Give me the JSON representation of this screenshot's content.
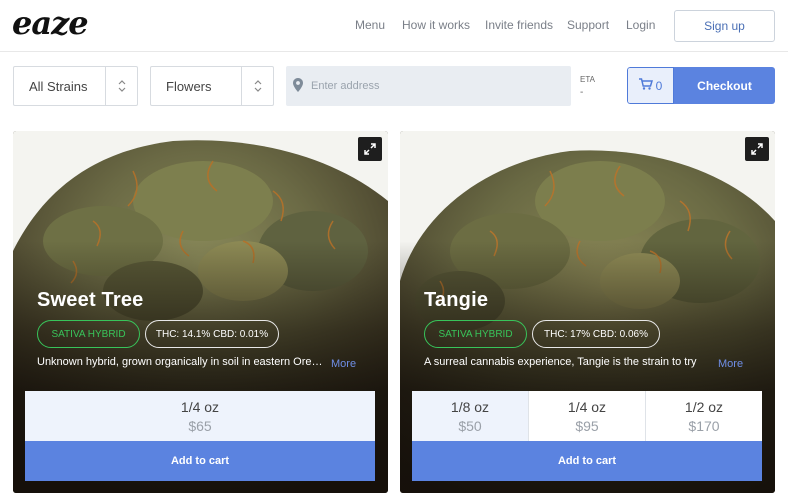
{
  "header": {
    "logo": "eaze",
    "nav": [
      "Menu",
      "How it works",
      "Invite friends",
      "Support",
      "Login"
    ],
    "signup_label": "Sign up"
  },
  "filters": {
    "strain": "All Strains",
    "category": "Flowers",
    "address_placeholder": "Enter address",
    "eta_label": "ETA",
    "eta_value": "-",
    "cart_count": "0",
    "checkout_label": "Checkout"
  },
  "products": [
    {
      "name": "Sweet Tree",
      "type": "SATIVA HYBRID",
      "potency": "THC: 14.1% CBD: 0.01%",
      "description": "Unknown hybrid, grown organically in soil in eastern Oregon",
      "more_label": "More",
      "options": [
        {
          "size": "1/4 oz",
          "price": "$65"
        }
      ],
      "add_label": "Add to cart"
    },
    {
      "name": "Tangie",
      "type": "SATIVA HYBRID",
      "potency": "THC: 17% CBD: 0.06%",
      "description": "A surreal cannabis experience, Tangie is the strain to try",
      "more_label": "More",
      "options": [
        {
          "size": "1/8 oz",
          "price": "$50"
        },
        {
          "size": "1/4 oz",
          "price": "$95"
        },
        {
          "size": "1/2 oz",
          "price": "$170"
        }
      ],
      "add_label": "Add to cart"
    }
  ],
  "colors": {
    "accent": "#5b83e0",
    "type_badge": "#38c45a"
  }
}
